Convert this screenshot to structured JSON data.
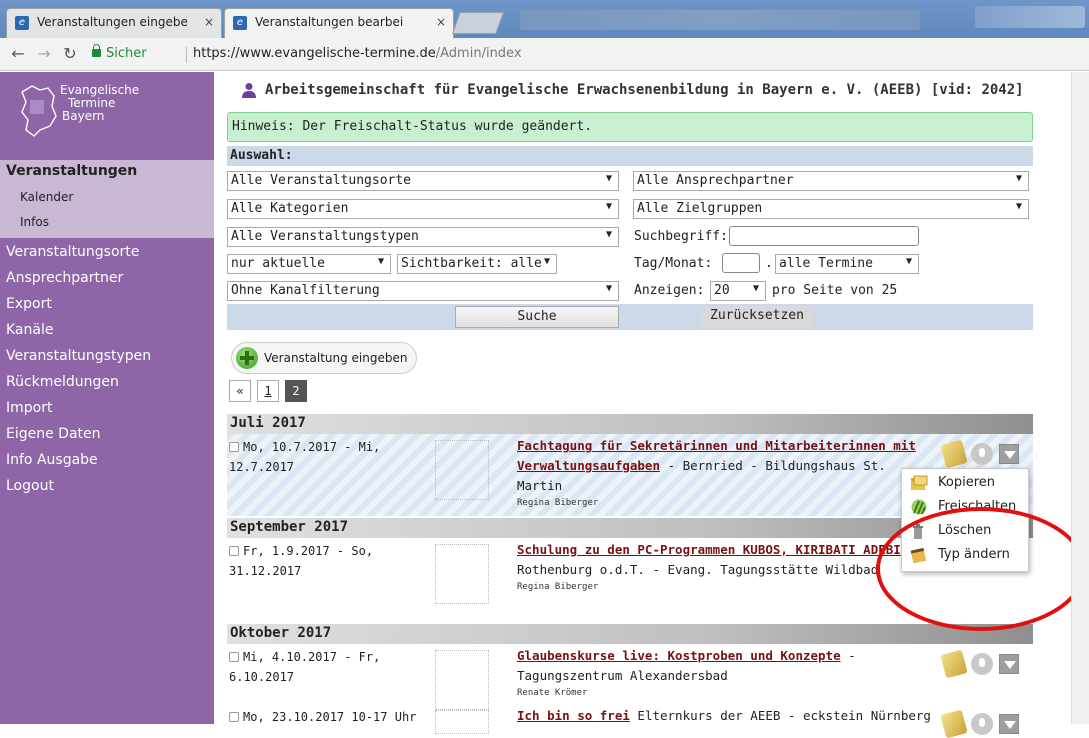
{
  "browser": {
    "tabs": [
      {
        "label": "Veranstaltungen eingebe",
        "close": "×"
      },
      {
        "label": "Veranstaltungen bearbei",
        "close": "×"
      }
    ],
    "secure_label": "Sicher",
    "url_host": "https://www.evangelische-termine.de",
    "url_path": "/Admin/index"
  },
  "sidebar": {
    "logo_lines": [
      "Evangelische",
      "Termine",
      "Bayern"
    ],
    "active_section": "Veranstaltungen",
    "sub_items": [
      "Kalender",
      "Infos"
    ],
    "items": [
      "Veranstaltungsorte",
      "Ansprechpartner",
      "Export",
      "Kanäle",
      "Veranstaltungstypen",
      "Rückmeldungen",
      "Import",
      "Eigene Daten",
      "Info Ausgabe",
      "Logout"
    ]
  },
  "header": {
    "org_title": "Arbeitsgemeinschaft für Evangelische Erwachsenenbildung in Bayern e. V. (AEEB) [vid: 2042]"
  },
  "notice": "Hinweis: Der Freischalt-Status wurde geändert.",
  "filters": {
    "heading": "Auswahl:",
    "orte": "Alle Veranstaltungsorte",
    "ansprechpartner": "Alle Ansprechpartner",
    "kategorien": "Alle Kategorien",
    "zielgruppen": "Alle Zielgruppen",
    "typen": "Alle Veranstaltungstypen",
    "suchbegriff_label": "Suchbegriff:",
    "zeitraum": "nur aktuelle",
    "sichtbarkeit": "Sichtbarkeit: alle",
    "tagmonat_label": "Tag/Monat:",
    "tagmonat_sep": ".",
    "termine": "alle Termine",
    "kanal": "Ohne Kanalfilterung",
    "anzeigen_label": "Anzeigen:",
    "anzeigen_value": "20",
    "pro_seite": "pro Seite von 25",
    "search_button": "Suche",
    "reset_button": "Zurücksetzen"
  },
  "add_event_button": "Veranstaltung eingeben",
  "pagination": {
    "prev": "«",
    "pages": [
      "1",
      "2"
    ],
    "current": "2"
  },
  "months": [
    {
      "label": "Juli 2017",
      "events": [
        {
          "date": "Mo, 10.7.2017 - Mi, 12.7.2017",
          "title": "Fachtagung für Sekretärinnen und Mitarbeiterinnen mit Verwaltungsaufgaben",
          "place": " - Bernried - Bildungshaus St. Martin",
          "contact": "Regina Biberger"
        }
      ]
    },
    {
      "label": "September 2017",
      "events": [
        {
          "date": "Fr, 1.9.2017 - So, 31.12.2017",
          "title": "Schulung zu den PC-Programmen KUBOS, KIRIBATI ADEBIS",
          "place": " - Rothenburg o.d.T. - Evang. Tagungsstätte Wildbad",
          "contact": "Regina Biberger"
        }
      ]
    },
    {
      "label": "Oktober 2017",
      "events": [
        {
          "date": "Mi, 4.10.2017 - Fr, 6.10.2017",
          "title": "Glaubenskurse live: Kostproben und Konzepte",
          "place": " - Tagungszentrum Alexandersbad",
          "contact": "Renate Krömer"
        },
        {
          "date": "Mo, 23.10.2017 10-17 Uhr",
          "title": "Ich bin so frei",
          "subtitle": " Elternkurs der AEEB",
          "place": " - eckstein Nürnberg",
          "contact": ""
        }
      ]
    }
  ],
  "context_menu": [
    "Kopieren",
    "Freischalten",
    "Löschen",
    "Typ ändern"
  ]
}
